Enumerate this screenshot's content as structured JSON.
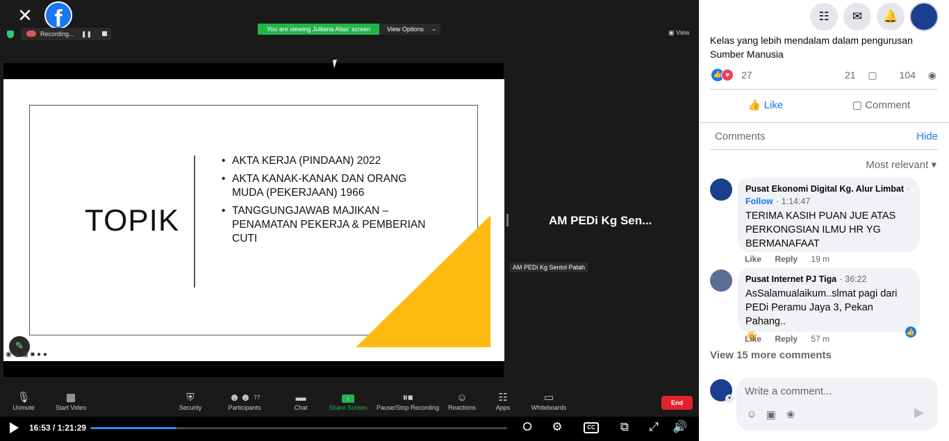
{
  "video": {
    "recording_label": "Recording...",
    "pause_glyph": "❚❚",
    "share_banner": "You are viewing Julliana Alias' screen",
    "view_options": "View Options",
    "view_button": "View",
    "slide": {
      "title": "TOPIK",
      "bullets": [
        "AKTA KERJA (PINDAAN) 2022",
        "AKTA KANAK-KANAK DAN ORANG MUDA (PEKERJAAN) 1966",
        "TANGGUNGJAWAB MAJIKAN – PENAMATAN PEKERJA & PEMBERIAN CUTI"
      ],
      "accent_color": "#fdbb11"
    },
    "participant_name": "AM PEDi Kg Sen...",
    "participant_tag": "AM PEDi Kg Sentol Patah",
    "toolbar": {
      "unmute": "Unmute",
      "start_video": "Start Video",
      "security": "Security",
      "participants": "Participants",
      "participants_count": "77",
      "chat": "Chat",
      "share_screen": "Share Screen",
      "recording": "Pause/Stop Recording",
      "reactions": "Reactions",
      "apps": "Apps",
      "whiteboards": "Whiteboards",
      "end": "End"
    },
    "player": {
      "time": "16:53 / 1:21:29",
      "progress_fraction": 0.207,
      "cc": "CC"
    }
  },
  "panel": {
    "caption": "Kelas yang lebih mendalam dalam pengurusan Sumber Manusia",
    "reaction_count": "27",
    "comment_count": "21",
    "view_count": "104",
    "like_label": "Like",
    "comment_label": "Comment",
    "comments_header": "Comments",
    "hide_label": "Hide",
    "sort_label": "Most relevant",
    "comments": [
      {
        "author": "Pusat Ekonomi Digital Kg. Alur Limbat",
        "follow": "Follow",
        "timestamp": "1:14:47",
        "text": "TERIMA KASIH PUAN JUE ATAS PERKONGSIAN ILMU HR YG BERMANAFAAT",
        "like": "Like",
        "reply": "Reply",
        "age": "19 m"
      },
      {
        "author": "Pusat Internet PJ Tiga",
        "timestamp": "36:22",
        "text": "AsSalamualaikum..slmat pagi dari PEDi Peramu Jaya 3, Pekan Pahang..",
        "emoji": "👋",
        "like": "Like",
        "reply": "Reply",
        "age": "57 m"
      }
    ],
    "view_more": "View 15 more comments",
    "input_placeholder": "Write a comment..."
  },
  "colors": {
    "facebook_blue": "#1877f2",
    "zoom_green": "#23b54d",
    "end_red": "#e0232e"
  }
}
